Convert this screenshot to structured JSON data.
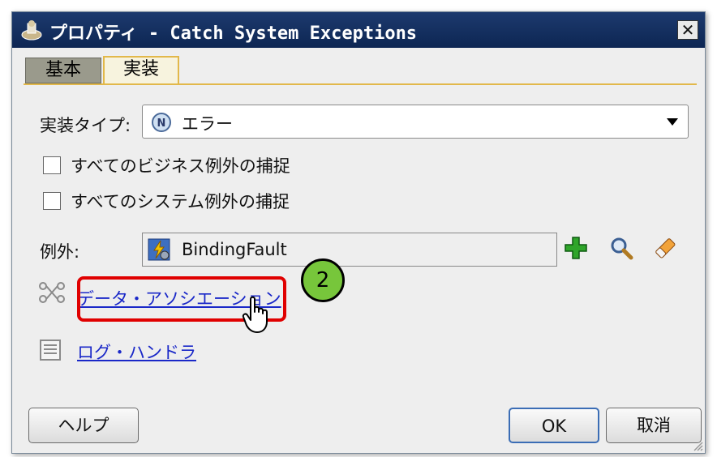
{
  "window": {
    "title": "プロパティ - Catch System Exceptions",
    "close_glyph": "✕"
  },
  "tabs": [
    {
      "label": "基本",
      "active": false
    },
    {
      "label": "実装",
      "active": true
    }
  ],
  "impl_type": {
    "label": "実装タイプ:",
    "selected": "エラー",
    "icon": "error-type-icon"
  },
  "checkboxes": [
    {
      "label": "すべてのビジネス例外の捕捉",
      "checked": false
    },
    {
      "label": "すべてのシステム例外の捕捉",
      "checked": false
    }
  ],
  "exception": {
    "label": "例外:",
    "value": "BindingFault",
    "tools": [
      "add-icon",
      "search-icon",
      "eraser-icon"
    ]
  },
  "links": {
    "data_association": "データ・アソシエーション",
    "log_handler": "ログ・ハンドラ"
  },
  "callout": {
    "number": "2",
    "highlight_color": "#e00000",
    "badge_color": "#77c63b"
  },
  "buttons": {
    "help": "ヘルプ",
    "ok": "OK",
    "cancel": "取消"
  },
  "colors": {
    "titlebar": "#0d2653",
    "tab_active_border": "#e2b84a",
    "link": "#1a28c8"
  }
}
